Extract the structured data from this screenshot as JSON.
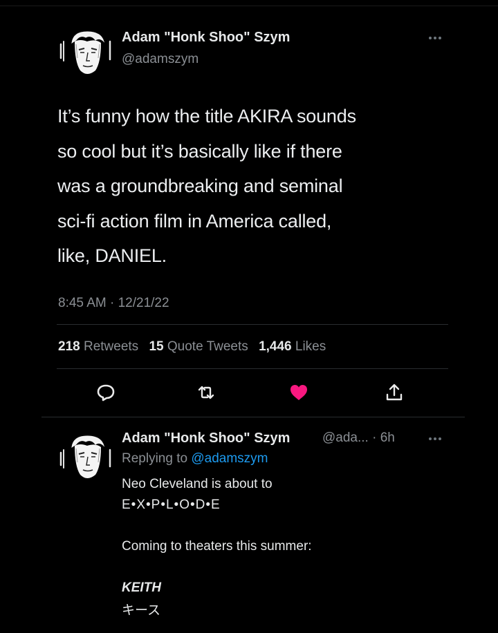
{
  "tweet": {
    "author_name": "Adam \"Honk Shoo\" Szym",
    "author_handle": "@adamszym",
    "text_lines": [
      "It’s funny how the title AKIRA sounds",
      "so cool but it’s basically like if there",
      "was a groundbreaking and seminal",
      "sci-fi action film in America called,",
      "like, DANIEL."
    ],
    "timestamp": "8:45 AM · 12/21/22",
    "stats": {
      "retweets_count": "218",
      "retweets_label": "Retweets",
      "quotes_count": "15",
      "quotes_label": "Quote Tweets",
      "likes_count": "1,446",
      "likes_label": "Likes"
    },
    "actions": [
      {
        "name": "reply-icon"
      },
      {
        "name": "retweet-icon"
      },
      {
        "name": "like-icon",
        "liked": true
      },
      {
        "name": "share-icon"
      }
    ]
  },
  "reply": {
    "author_name": "Adam \"Honk Shoo\" Szym",
    "meta": "@ada... · 6h",
    "replying_prefix": "Replying to",
    "replying_to": "@adamszym",
    "lines": [
      "Neo Cleveland is about to",
      "E•X•P•L•O•D•E",
      "Coming to theaters this summer:",
      "KEITH",
      "キース"
    ]
  },
  "colors": {
    "background": "#000000",
    "text": "#e7e9ea",
    "muted": "#8b8f94",
    "link": "#1d9bf0",
    "like": "#f91880"
  }
}
